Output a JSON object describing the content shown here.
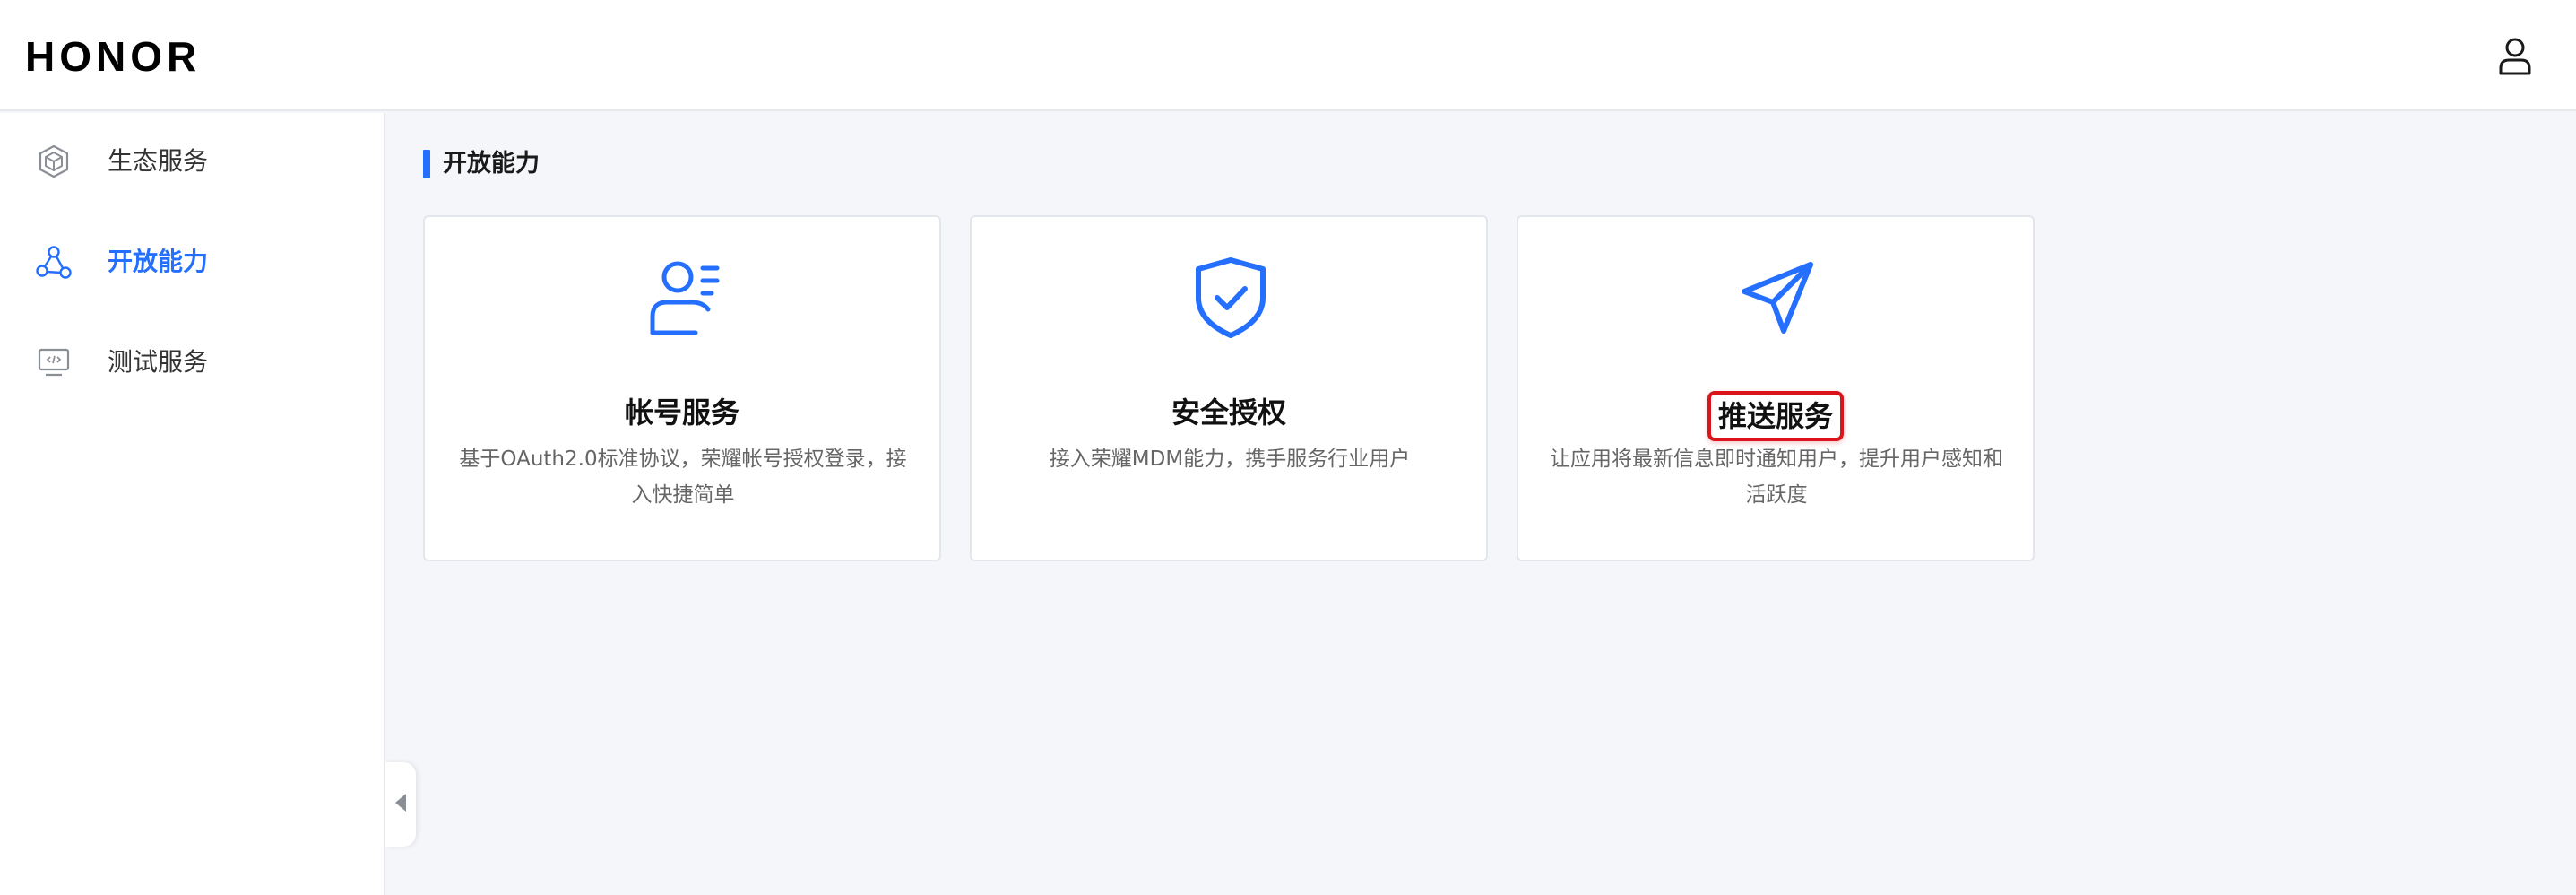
{
  "header": {
    "logo_text": "HONOR",
    "user_icon": "user-icon"
  },
  "sidebar": {
    "items": [
      {
        "label": "生态服务",
        "icon": "cube-icon",
        "active": false
      },
      {
        "label": "开放能力",
        "icon": "nodes-icon",
        "active": true
      },
      {
        "label": "测试服务",
        "icon": "monitor-code-icon",
        "active": false
      }
    ],
    "collapse_icon": "caret-left-icon"
  },
  "main": {
    "section_title": "开放能力",
    "cards": [
      {
        "title": "帐号服务",
        "description": "基于OAuth2.0标准协议，荣耀帐号授权登录，接入快捷简单",
        "icon": "account-icon",
        "highlighted": false
      },
      {
        "title": "安全授权",
        "description": "接入荣耀MDM能力，携手服务行业用户",
        "icon": "shield-check-icon",
        "highlighted": false
      },
      {
        "title": "推送服务",
        "description": "让应用将最新信息即时通知用户，提升用户感知和活跃度",
        "icon": "send-icon",
        "highlighted": true
      }
    ]
  },
  "colors": {
    "accent": "#256fff",
    "highlight_border": "#d9141b",
    "background": "#f4f6f9"
  }
}
